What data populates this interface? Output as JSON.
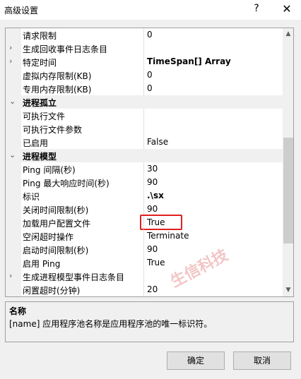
{
  "window": {
    "title": "高级设置",
    "help": "?",
    "close": "✕"
  },
  "grid": {
    "rows": [
      {
        "name": "请求限制",
        "value": "0",
        "type": "item"
      },
      {
        "name": "生成回收事件日志条目",
        "value": "",
        "type": "item",
        "expander": "›"
      },
      {
        "name": "特定时间",
        "value": "TimeSpan[] Array",
        "type": "item",
        "expander": "›"
      },
      {
        "name": "虚拟内存限制(KB)",
        "value": "0",
        "type": "item"
      },
      {
        "name": "专用内存限制(KB)",
        "value": "0",
        "type": "item"
      },
      {
        "name": "进程孤立",
        "value": "",
        "type": "category",
        "expander": "⌄"
      },
      {
        "name": "可执行文件",
        "value": "",
        "type": "item"
      },
      {
        "name": "可执行文件参数",
        "value": "",
        "type": "item"
      },
      {
        "name": "已启用",
        "value": "False",
        "type": "item"
      },
      {
        "name": "进程模型",
        "value": "",
        "type": "category",
        "expander": "⌄"
      },
      {
        "name": "Ping 间隔(秒)",
        "value": "30",
        "type": "item"
      },
      {
        "name": "Ping 最大响应时间(秒)",
        "value": "90",
        "type": "item"
      },
      {
        "name": "标识",
        "value": ".\\sx",
        "type": "item"
      },
      {
        "name": "关闭时间限制(秒)",
        "value": "90",
        "type": "item"
      },
      {
        "name": "加载用户配置文件",
        "value": "True",
        "type": "item"
      },
      {
        "name": "空闲超时操作",
        "value": "Terminate",
        "type": "item"
      },
      {
        "name": "启动时间限制(秒)",
        "value": "90",
        "type": "item"
      },
      {
        "name": "启用 Ping",
        "value": "True",
        "type": "item"
      },
      {
        "name": "生成进程模型事件日志条目",
        "value": "",
        "type": "item",
        "expander": "›"
      },
      {
        "name": "闲置超时(分钟)",
        "value": "20",
        "type": "item"
      }
    ],
    "scroll_up": "▲",
    "scroll_down": "▼"
  },
  "watermark": "生信科技",
  "description": {
    "title": "名称",
    "text": "[name] 应用程序池名称是应用程序池的唯一标识符。"
  },
  "buttons": {
    "ok": "确定",
    "cancel": "取消"
  }
}
